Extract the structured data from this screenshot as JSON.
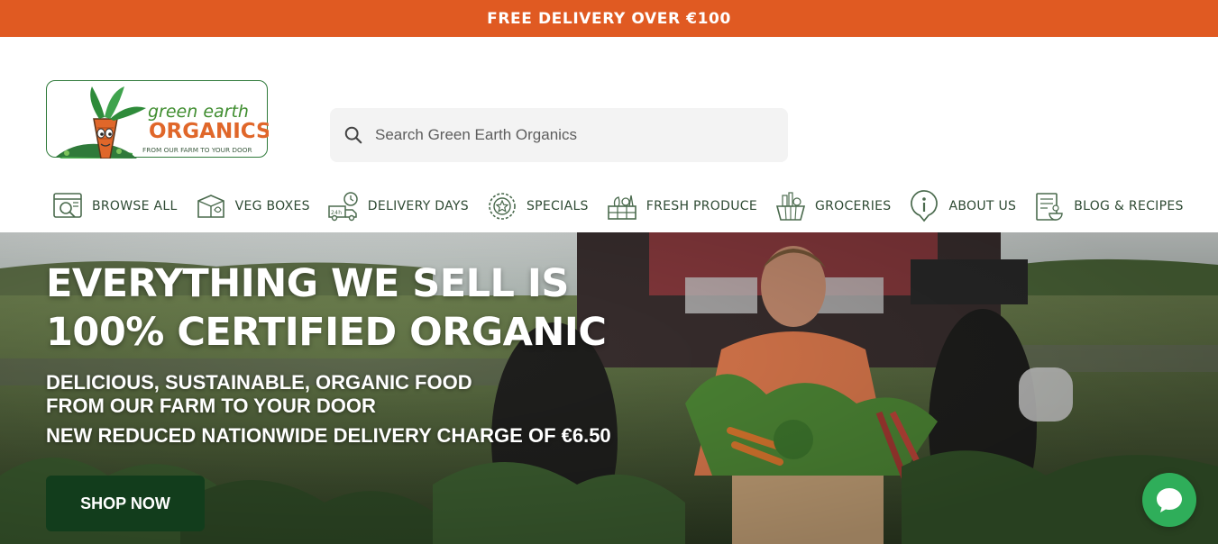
{
  "announcement": {
    "text": "FREE DELIVERY OVER €100"
  },
  "logo": {
    "line1": "green earth",
    "line2": "ORGANICS",
    "tagline": "FROM OUR FARM TO YOUR DOOR"
  },
  "search": {
    "placeholder": "Search Green Earth Organics",
    "icon": "search-icon"
  },
  "nav": {
    "items": [
      {
        "label": "BROWSE ALL",
        "icon": "browse-icon"
      },
      {
        "label": "VEG BOXES",
        "icon": "box-icon"
      },
      {
        "label": "DELIVERY DAYS",
        "icon": "delivery-icon"
      },
      {
        "label": "SPECIALS",
        "icon": "star-badge-icon"
      },
      {
        "label": "FRESH PRODUCE",
        "icon": "produce-crate-icon"
      },
      {
        "label": "GROCERIES",
        "icon": "basket-icon"
      },
      {
        "label": "ABOUT US",
        "icon": "info-icon"
      },
      {
        "label": "BLOG & RECIPES",
        "icon": "recipe-icon"
      }
    ]
  },
  "hero": {
    "title_line1": "EVERYTHING WE SELL IS",
    "title_line2": "100% CERTIFIED ORGANIC",
    "sub_line1": "DELICIOUS, SUSTAINABLE, ORGANIC FOOD",
    "sub_line2": "FROM OUR FARM TO YOUR DOOR",
    "note": "NEW REDUCED NATIONWIDE DELIVERY CHARGE OF €6.50",
    "cta": "SHOP NOW"
  },
  "chat": {
    "icon": "chat-bubble-icon"
  },
  "colors": {
    "accent": "#e05a22",
    "brand_green": "#2f7a3a",
    "cta_green": "#123d1c",
    "chat_green": "#2fae5a"
  }
}
